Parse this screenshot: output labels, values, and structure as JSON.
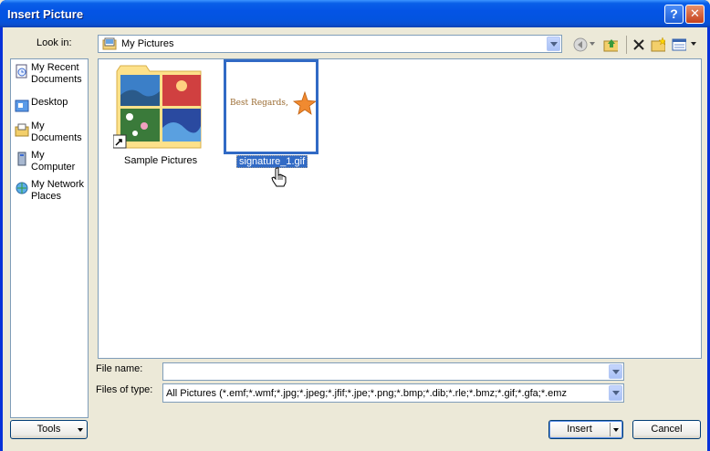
{
  "window": {
    "title": "Insert Picture",
    "help": "?",
    "close": "✕"
  },
  "lookin": {
    "label": "Look in:",
    "value": "My Pictures"
  },
  "places": [
    {
      "label_lines": [
        "My Recent",
        "Documents"
      ]
    },
    {
      "label_lines": [
        "Desktop"
      ]
    },
    {
      "label_lines": [
        "My",
        "Documents"
      ]
    },
    {
      "label_lines": [
        "My",
        "Computer"
      ]
    },
    {
      "label_lines": [
        "My Network",
        "Places"
      ]
    }
  ],
  "files": [
    {
      "name": "Sample Pictures",
      "selected": false
    },
    {
      "name": "signature_1.gif",
      "selected": true,
      "preview_text": "Best Regards,"
    }
  ],
  "filename": {
    "label": "File name:",
    "value": ""
  },
  "filetype": {
    "label": "Files of type:",
    "value": "All Pictures (*.emf;*.wmf;*.jpg;*.jpeg;*.jfif;*.jpe;*.png;*.bmp;*.dib;*.rle;*.bmz;*.gif;*.gfa;*.emz"
  },
  "buttons": {
    "tools": "Tools",
    "insert": "Insert",
    "cancel": "Cancel"
  },
  "colors": {
    "titlebar": "#0454e5",
    "selection": "#316ac5",
    "face": "#ece9d8"
  },
  "icons": [
    "back-icon",
    "up-folder-icon",
    "delete-icon",
    "new-folder-icon",
    "views-icon"
  ]
}
